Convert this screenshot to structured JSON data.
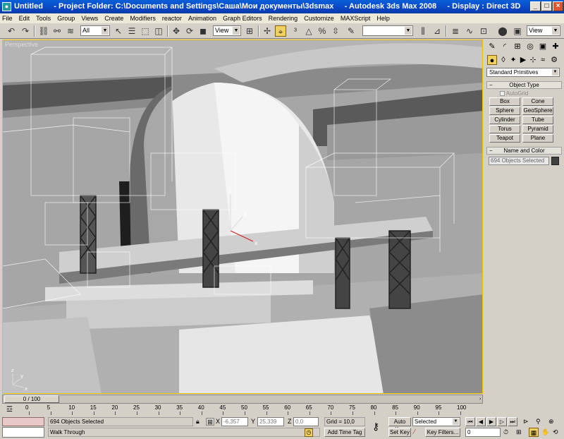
{
  "window": {
    "title": "Untitled     - Project Folder: C:\\Documents and Settings\\Саша\\Мои документы\\3dsmax     - Autodesk 3ds Max 2008     - Display : Direct 3D",
    "minimize": "_",
    "maximize": "□",
    "close": "×"
  },
  "menu": [
    "File",
    "Edit",
    "Tools",
    "Group",
    "Views",
    "Create",
    "Modifiers",
    "reactor",
    "Animation",
    "Graph Editors",
    "Rendering",
    "Customize",
    "MAXScript",
    "Help"
  ],
  "toolbar": {
    "selection_filter": "All",
    "reference_coord": "View",
    "named_selection": "",
    "view_dropdown": "View"
  },
  "viewport": {
    "label": "Perspective",
    "accent_color": "#e8c000",
    "axes": {
      "x": "x",
      "y": "y",
      "z": "z"
    }
  },
  "command_panel": {
    "primitive_type": "Standard Primitives",
    "object_type_title": "Object Type",
    "autogrid": "AutoGrid",
    "buttons": [
      "Box",
      "Cone",
      "Sphere",
      "GeoSphere",
      "Cylinder",
      "Tube",
      "Torus",
      "Pyramid",
      "Teapot",
      "Plane"
    ],
    "name_color_title": "Name and Color",
    "name_field": "694 Objects Selected"
  },
  "timeline": {
    "frame": "0 / 100",
    "ticks": [
      "0",
      "5",
      "10",
      "15",
      "20",
      "25",
      "30",
      "35",
      "40",
      "45",
      "50",
      "55",
      "60",
      "65",
      "70",
      "75",
      "80",
      "85",
      "90",
      "95",
      "100"
    ]
  },
  "status": {
    "selection": "694 Objects Selected",
    "prompt": "Walk Through",
    "x_label": "X",
    "x_value": "-6,357",
    "y_label": "Y",
    "y_value": "25,339",
    "z_label": "Z",
    "z_value": "0,0",
    "grid": "Grid = 10,0",
    "add_time_tag": "Add Time Tag",
    "auto_key": "Auto Key",
    "set_key": "Set Key",
    "key_mode": "Selected",
    "key_filters": "Key Filters...",
    "current_frame": "0"
  }
}
